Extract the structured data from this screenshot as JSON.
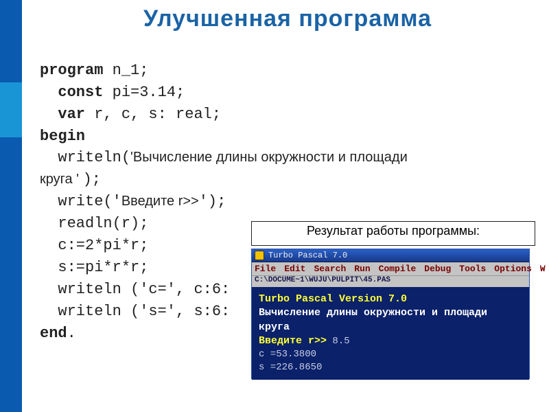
{
  "title": "Улучшенная программа",
  "code": {
    "kw_program": "program",
    "prog_name": " n_1;",
    "kw_const": "const",
    "const_decl": " pi=3.14;",
    "kw_var": "var",
    "var_decl": " r, c, s: real;",
    "kw_begin": "begin",
    "writeln1a": "writeln(",
    "writeln1_str": "'Вычисление длины окружности и площади",
    "writeln1_cont": "круга ' ",
    "writeln1_end": ");",
    "write_a": "write('",
    "write_str": "Введите r>>",
    "write_b": "');",
    "readln": "readln(r);",
    "l_c": "c:=2*pi*r;",
    "l_s": "s:=pi*r*r;",
    "wl_c": "writeln ('c=', c:6:",
    "wl_s": "writeln ('s=', s:6:",
    "kw_end": "end",
    "dot": "."
  },
  "result_label": "Результат работы программы:",
  "tp": {
    "titlebar": "Turbo Pascal 7.0",
    "menu": [
      "File",
      "Edit",
      "Search",
      "Run",
      "Compile",
      "Debug",
      "Tools",
      "Options",
      "W"
    ],
    "path": "C:\\DOCUME~1\\WUJU\\PULPIT\\45.PAS",
    "line1a": "Turbo Pascal   Version 7.0",
    "line2": "Вычисление длины окружности и площади круга",
    "line3a": "Введите r>>",
    "line3b": " 8.5",
    "line4": "c  =53.3800",
    "line5": "s  =226.8650"
  }
}
